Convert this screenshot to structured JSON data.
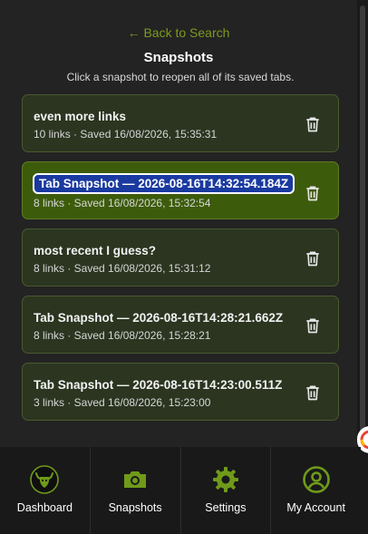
{
  "header": {
    "back_label": "← Back to Search",
    "title": "Snapshots",
    "subtitle": "Click a snapshot to reopen all of its saved tabs."
  },
  "snapshots": [
    {
      "name": "even more links",
      "meta": "10 links · Saved 16/08/2026, 15:35:31",
      "active": false
    },
    {
      "name": "Tab Snapshot — 2026-08-16T14:32:54.184Z",
      "meta": "8 links · Saved 16/08/2026, 15:32:54",
      "active": true
    },
    {
      "name": "most recent I guess?",
      "meta": "8 links · Saved 16/08/2026, 15:31:12",
      "active": false
    },
    {
      "name": "Tab Snapshot — 2026-08-16T14:28:21.662Z",
      "meta": "8 links · Saved 16/08/2026, 15:28:21",
      "active": false
    },
    {
      "name": "Tab Snapshot — 2026-08-16T14:23:00.511Z",
      "meta": "3 links · Saved 16/08/2026, 15:23:00",
      "active": false
    }
  ],
  "nav": [
    {
      "label": "Dashboard",
      "icon": "viking-logo-icon"
    },
    {
      "label": "Snapshots",
      "icon": "camera-icon"
    },
    {
      "label": "Settings",
      "icon": "gear-icon"
    },
    {
      "label": "My Account",
      "icon": "user-circle-icon"
    }
  ],
  "colors": {
    "accent": "#7c9a1e",
    "card_bg": "#2b3520",
    "card_active_bg": "#3d5c0b",
    "nav_icon": "#6f9a1a"
  }
}
